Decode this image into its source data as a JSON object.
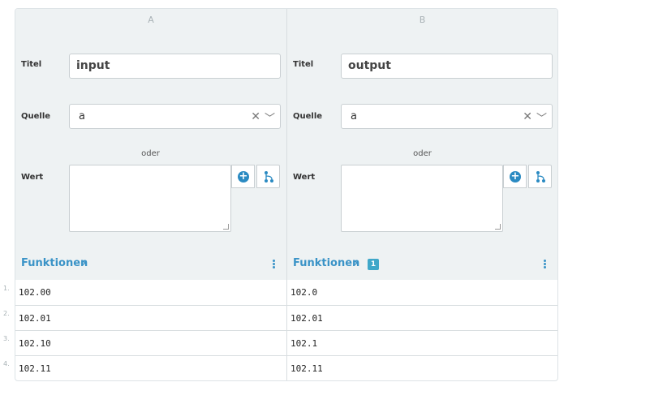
{
  "columns": [
    {
      "letter": "A",
      "titel_label": "Titel",
      "titel_value": "input",
      "quelle_label": "Quelle",
      "quelle_value": "a",
      "oder_label": "oder",
      "wert_label": "Wert",
      "funktionen_label": "Funktionen",
      "funktionen_badge": "",
      "cells": [
        "102.00",
        "102.01",
        "102.10",
        "102.11"
      ]
    },
    {
      "letter": "B",
      "titel_label": "Titel",
      "titel_value": "output",
      "quelle_label": "Quelle",
      "quelle_value": "a",
      "oder_label": "oder",
      "wert_label": "Wert",
      "funktionen_label": "Funktionen",
      "funktionen_badge": "1",
      "cells": [
        "102.0",
        "102.01",
        "102.1",
        "102.11"
      ]
    }
  ],
  "row_numbers": [
    "1.",
    "2.",
    "3.",
    "4."
  ],
  "icons": {
    "clear": "close-icon",
    "dropdown": "chevron-down-icon",
    "add": "plus-circle-icon",
    "branch": "branch-icon",
    "expand": "chevron-right-icon",
    "menu": "kebab-menu-icon"
  },
  "colors": {
    "accent": "#3a93c7",
    "header_bg": "#eef2f3",
    "badge": "#3fa7c9"
  }
}
